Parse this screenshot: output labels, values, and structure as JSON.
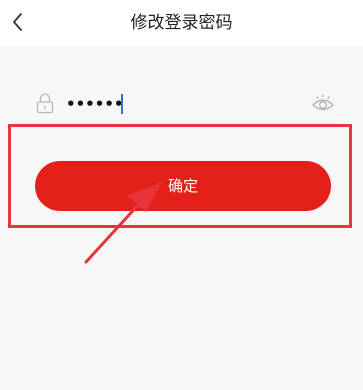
{
  "header": {
    "title": "修改登录密码",
    "back_icon": "chevron-left-icon"
  },
  "password_field": {
    "value": "••••••",
    "lock_icon": "lock-icon",
    "visibility_icon": "eye-icon"
  },
  "confirm_button": {
    "label": "确定"
  },
  "colors": {
    "primary_red": "#e4201a",
    "annotation_red": "#e8333b",
    "background": "#f7f7f7"
  }
}
